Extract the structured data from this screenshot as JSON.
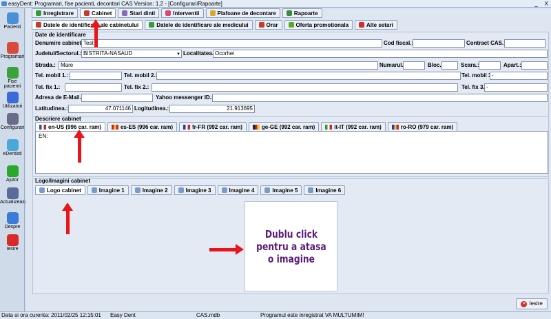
{
  "window": {
    "title": "easyDent: Programari,  fise pacienti, decontari CAS   Version: 1.2 - [Configurari/Rapoarte]",
    "controls": [
      "_",
      "X"
    ]
  },
  "sidebar": {
    "items": [
      {
        "label": "Pacienti",
        "icon": "patient-icon",
        "color": "#4a90d9"
      },
      {
        "label": "Programari",
        "icon": "calendar-icon",
        "color": "#d84a3a"
      },
      {
        "label": "Fise pacienti",
        "icon": "patient-file-icon",
        "color": "#3aa33a"
      },
      {
        "label": "Utilizatori",
        "icon": "users-icon",
        "color": "#3a6ad8"
      },
      {
        "label": "Configurari",
        "icon": "settings-icon",
        "color": "#6a6a8a"
      },
      {
        "label": "eDentisti",
        "icon": "dentists-icon",
        "color": "#4aa8d8"
      },
      {
        "label": "Ajutor",
        "icon": "help-icon",
        "color": "#2aa82a"
      },
      {
        "label": "Actualizeaza",
        "icon": "update-icon",
        "color": "#5a6a9a"
      },
      {
        "label": "Despre",
        "icon": "info-icon",
        "color": "#3a7ad8"
      },
      {
        "label": "Iesire",
        "icon": "exit-icon",
        "color": "#d82a2a"
      }
    ]
  },
  "top_tabs": [
    {
      "label": "Inregistrare",
      "color": "#3a9a3a"
    },
    {
      "label": "Cabinet",
      "color": "#c83a2a"
    },
    {
      "label": "Stari dinti",
      "color": "#8a6ab8"
    },
    {
      "label": "Interventii",
      "color": "#d84a6a"
    },
    {
      "label": "Plafoane de decontare",
      "color": "#d8a82a"
    },
    {
      "label": "Rapoarte",
      "color": "#3a8a3a"
    }
  ],
  "sub_tabs": [
    {
      "label": "Datele de identificare ale cabinetului",
      "color": "#c83a2a"
    },
    {
      "label": "Datele de identificare ale medicului",
      "color": "#3a9a3a"
    },
    {
      "label": "Orar",
      "color": "#c83a2a"
    },
    {
      "label": "Oferta promotionala",
      "color": "#5aa82a"
    },
    {
      "label": "Alte setari",
      "color": "#d82a2a"
    }
  ],
  "identification": {
    "group_title": "Date de identificare",
    "denumire_label": "Denumire cabinet.:",
    "denumire_value": "Test",
    "cod_fiscal_label": "Cod fiscal.:",
    "cod_fiscal_value": "",
    "contract_label": "Contract CAS.:",
    "contract_value": "",
    "judet_label": "Judetul/Sectorul.:",
    "judet_value": "BISTRITA-NASAUD",
    "localitate_label": "Localitatea.:",
    "localitate_value": "Ocorhei",
    "strada_label": "Strada.:",
    "strada_value": "Mare",
    "numarul_label": "Numarul.:",
    "numarul_value": "",
    "bloc_label": "Bloc.:",
    "bloc_value": "",
    "scara_label": "Scara.:",
    "scara_value": "",
    "apart_label": "Apart.:",
    "apart_value": "",
    "mobil1_label": "Tel. mobil 1.:",
    "mobil1_value": "",
    "mobil2_label": "Tel. mobil 2.:",
    "mobil2_value": "",
    "mobil3_label": "Tel. mobil 3.:",
    "mobil3_value": "-",
    "fix1_label": "Tel. fix 1.:",
    "fix1_value": "",
    "fix2_label": "Tel. fix 2.:",
    "fix2_value": "",
    "fix3_label": "Tel. fix 3.:",
    "fix3_value": "-",
    "email_label": "Adresa de E-Mail.:",
    "email_value": "",
    "yahoo_label": "Yahoo messenger ID.:",
    "yahoo_value": "",
    "lat_label": "Latitudinea.:",
    "lat_value": "47.071146",
    "long_label": "Logitudinea.:",
    "long_value": "21.913695"
  },
  "description": {
    "group_title": "Descriere cabinet",
    "lang_tabs": [
      {
        "label": "en-US (996 car. ram)",
        "flag": [
          "#3a4aa8",
          "#ffffff",
          "#c82a2a"
        ]
      },
      {
        "label": "es-ES (996 car. ram)",
        "flag": [
          "#c82a2a",
          "#f0c82a",
          "#c82a2a"
        ]
      },
      {
        "label": "fr-FR (992 car. ram)",
        "flag": [
          "#2a3aa8",
          "#ffffff",
          "#c82a2a"
        ]
      },
      {
        "label": "ge-GE (992 car. ram)",
        "flag": [
          "#222222",
          "#c82a2a",
          "#f0c82a"
        ]
      },
      {
        "label": "it-IT (992 car. ram)",
        "flag": [
          "#2a9a3a",
          "#ffffff",
          "#c82a2a"
        ]
      },
      {
        "label": "ro-RO (979 car. ram)",
        "flag": [
          "#2a3aa8",
          "#f0c82a",
          "#c82a2a"
        ]
      }
    ],
    "text": "EN:"
  },
  "logo": {
    "group_title": "Logo/Imagini cabinet",
    "tabs": [
      "Logo cabinet",
      "Imagine 1",
      "Imagine 2",
      "Imagine 3",
      "Imagine 4",
      "Imagine 5",
      "Imagine 6"
    ],
    "placeholder_line1": "Dublu click",
    "placeholder_line2": "pentru a atasa",
    "placeholder_line3": "o imagine"
  },
  "exit_button": {
    "label": "Iesire"
  },
  "statusbar": {
    "datetime": "Data si ora curenta: 2011/02/25 12:15:01",
    "app": "Easy Dent",
    "db": "CAS.mdb",
    "message": "Programul este inregistrat VA MULTUMIM!"
  },
  "colors": {
    "annotation_arrow": "#e8161a",
    "placeholder_text": "#5a1a7a"
  }
}
